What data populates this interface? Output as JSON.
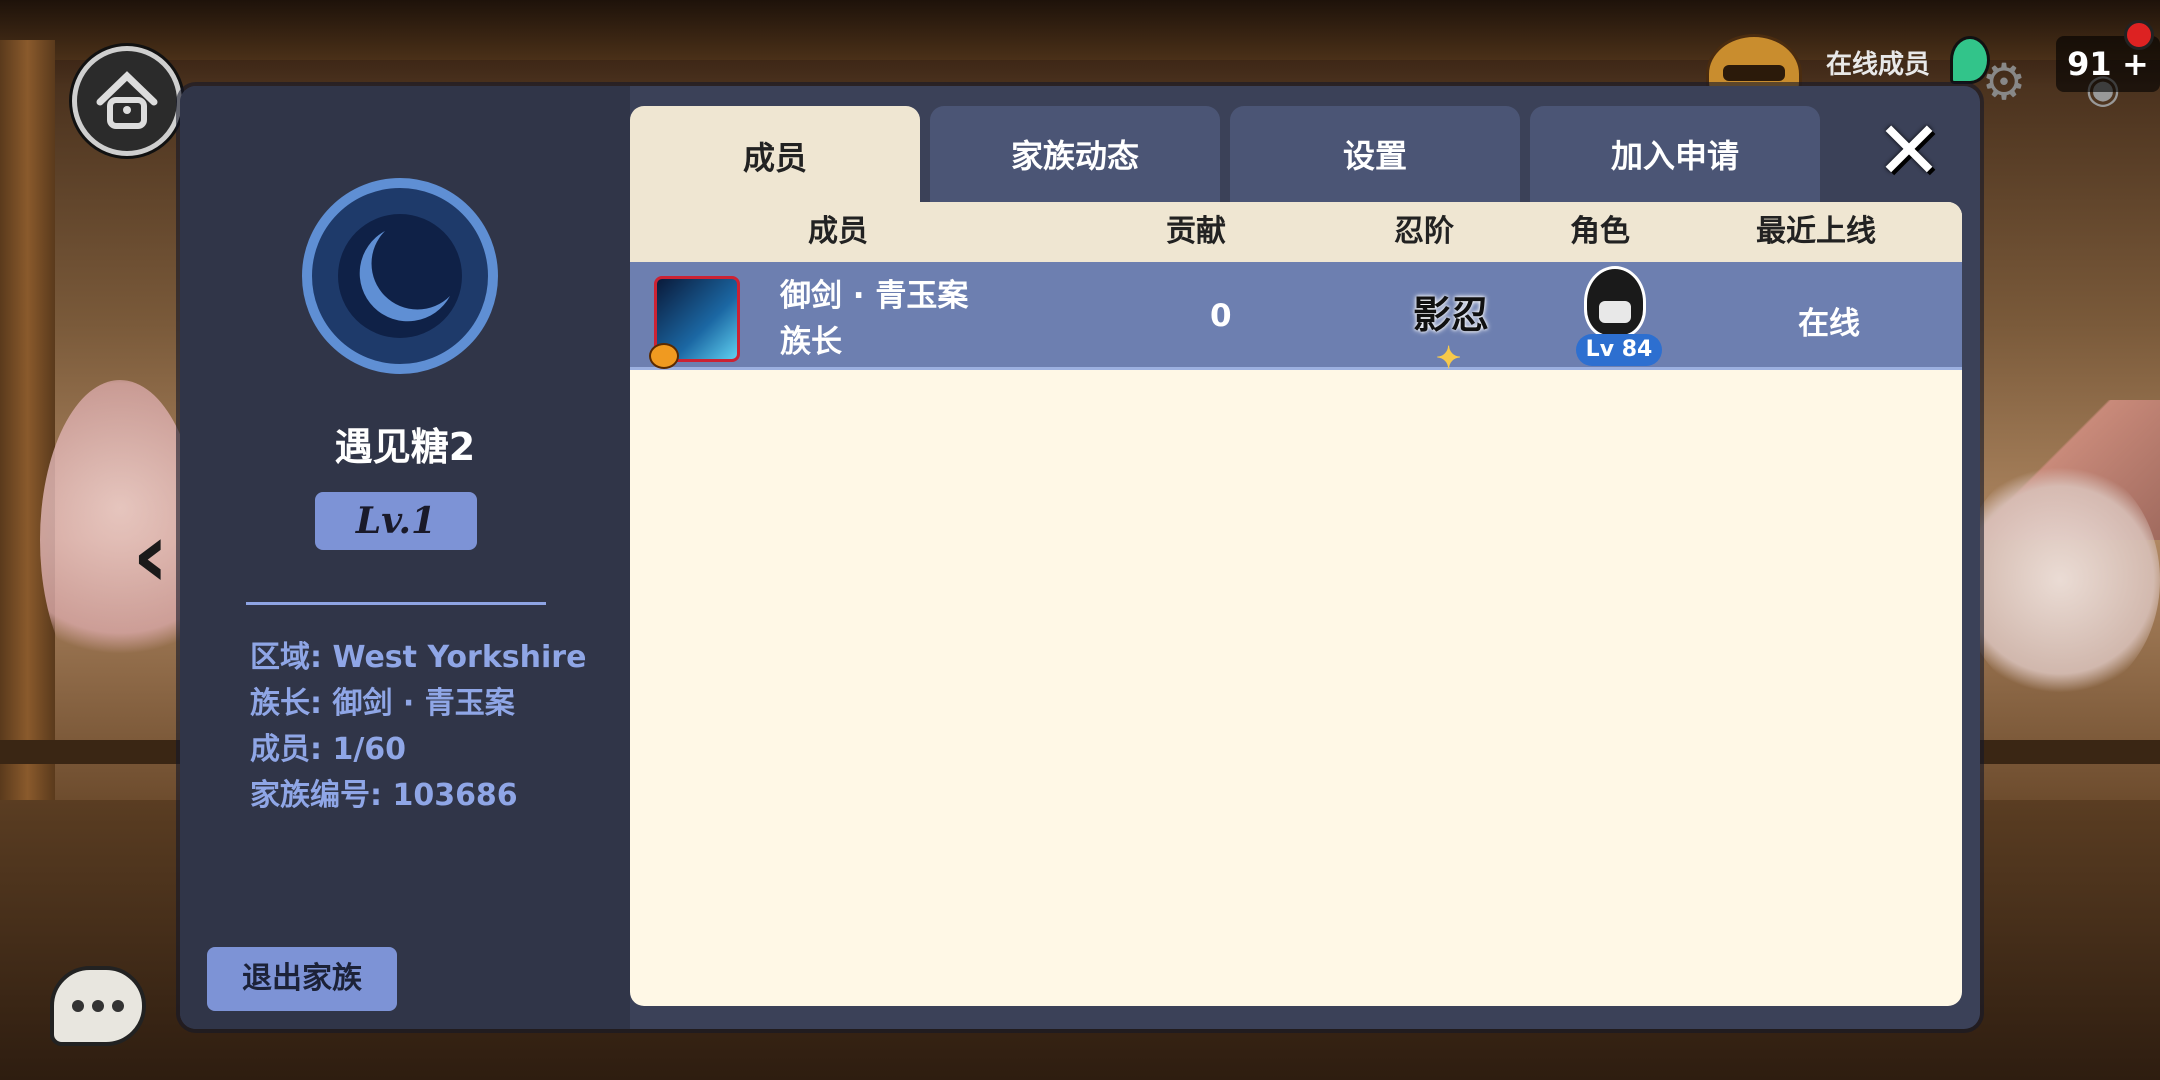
{
  "hud": {
    "online_label": "在线成员",
    "energy_value": "91",
    "energy_plus": "+"
  },
  "side": {
    "clan_name": "遇见糖2",
    "clan_level": "Lv.1",
    "info": [
      "区域: West Yorkshire",
      "族长: 御剑 · 青玉案",
      "成员: 1/60",
      "家族编号: 103686"
    ],
    "quit_label": "退出家族"
  },
  "tabs": [
    {
      "label": "成员",
      "active": true
    },
    {
      "label": "家族动态",
      "active": false
    },
    {
      "label": "设置",
      "active": false
    },
    {
      "label": "加入申请",
      "active": false
    }
  ],
  "table": {
    "headers": [
      "成员",
      "贡献",
      "忍阶",
      "角色",
      "最近上线"
    ],
    "rows": [
      {
        "name": "御剑 · 青玉案",
        "title": "族长",
        "contribution": "0",
        "rank": "影忍",
        "char_level": "Lv 84",
        "last_online": "在线"
      }
    ]
  },
  "icons": {
    "home": "home-icon",
    "close": "close-icon",
    "chat": "chat-icon",
    "settings": "gear-icon",
    "back": "chevron-left-icon"
  },
  "colors": {
    "panel": "#3b4158",
    "sidebar": "#303548",
    "accent": "#7d93d6",
    "row_highlight": "#6d7fb0",
    "table_bg": "#fff8e6"
  }
}
